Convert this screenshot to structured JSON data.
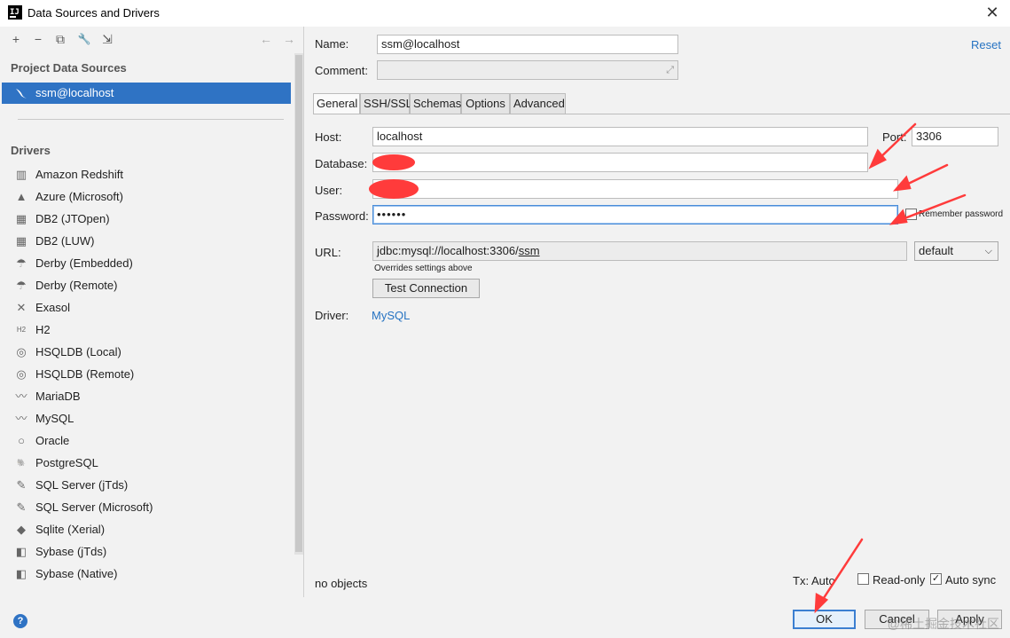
{
  "window": {
    "title": "Data Sources and Drivers",
    "app_icon_text": "IJ",
    "close_glyph": "✕"
  },
  "toolbar": {
    "add": "+",
    "remove": "−",
    "copy": "⧉",
    "wrench": "🔧",
    "import": "⇲",
    "back": "←",
    "forward": "→"
  },
  "sidebar": {
    "project_sources_label": "Project Data Sources",
    "data_sources": [
      {
        "label": "ssm@localhost"
      }
    ],
    "drivers_label": "Drivers",
    "drivers": [
      {
        "label": "Amazon Redshift",
        "icon": "▥"
      },
      {
        "label": "Azure (Microsoft)",
        "icon": "▲"
      },
      {
        "label": "DB2 (JTOpen)",
        "icon": "▦"
      },
      {
        "label": "DB2 (LUW)",
        "icon": "▦"
      },
      {
        "label": "Derby (Embedded)",
        "icon": "☂"
      },
      {
        "label": "Derby (Remote)",
        "icon": "☂"
      },
      {
        "label": "Exasol",
        "icon": "✕"
      },
      {
        "label": "H2",
        "icon": "H2"
      },
      {
        "label": "HSQLDB (Local)",
        "icon": "◎"
      },
      {
        "label": "HSQLDB (Remote)",
        "icon": "◎"
      },
      {
        "label": "MariaDB",
        "icon": "〰"
      },
      {
        "label": "MySQL",
        "icon": "〰"
      },
      {
        "label": "Oracle",
        "icon": "○"
      },
      {
        "label": "PostgreSQL",
        "icon": "🐘"
      },
      {
        "label": "SQL Server (jTds)",
        "icon": "✎"
      },
      {
        "label": "SQL Server (Microsoft)",
        "icon": "✎"
      },
      {
        "label": "Sqlite (Xerial)",
        "icon": "◆"
      },
      {
        "label": "Sybase (jTds)",
        "icon": "◧"
      },
      {
        "label": "Sybase (Native)",
        "icon": "◧"
      }
    ]
  },
  "form": {
    "name_label": "Name:",
    "name_value": "ssm@localhost",
    "comment_label": "Comment:",
    "comment_value": "",
    "reset_label": "Reset",
    "tabs": [
      "General",
      "SSH/SSL",
      "Schemas",
      "Options",
      "Advanced"
    ],
    "host_label": "Host:",
    "host_value": "localhost",
    "port_label": "Port:",
    "port_value": "3306",
    "database_label": "Database:",
    "database_value": "",
    "user_label": "User:",
    "user_value": "",
    "password_label": "Password:",
    "password_value": "••••••",
    "remember_password_label": "Remember password",
    "url_label": "URL:",
    "url_prefix": "jdbc:mysql://localhost:3306/",
    "url_db": "ssm",
    "url_mode": "default",
    "url_hint": "Overrides settings above",
    "test_connection_label": "Test Connection",
    "driver_label": "Driver:",
    "driver_value": "MySQL",
    "status_text": "no objects",
    "tx_label": "Tx: Auto",
    "readonly_label": "Read-only",
    "readonly_checked": false,
    "autosync_label": "Auto sync",
    "autosync_checked": true
  },
  "footer": {
    "help_glyph": "?",
    "ok_label": "OK",
    "cancel_label": "Cancel",
    "apply_label": "Apply",
    "watermark": "@稀土掘金技术社区"
  },
  "colors": {
    "selection": "#2f73c4",
    "link": "#2673c2",
    "annotation": "#ff3b3b"
  }
}
